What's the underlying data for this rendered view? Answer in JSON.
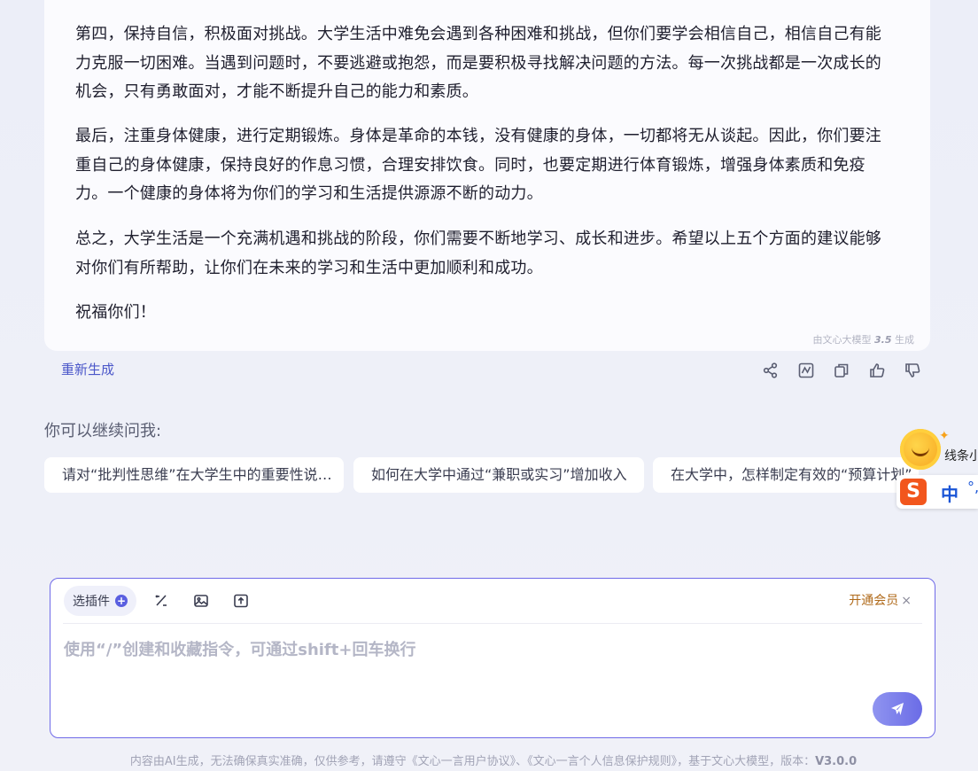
{
  "answer": {
    "paragraphs": [
      "第四，保持自信，积极面对挑战。大学生活中难免会遇到各种困难和挑战，但你们要学会相信自己，相信自己有能力克服一切困难。当遇到问题时，不要逃避或抱怨，而是要积极寻找解决问题的方法。每一次挑战都是一次成长的机会，只有勇敢面对，才能不断提升自己的能力和素质。",
      "最后，注重身体健康，进行定期锻炼。身体是革命的本钱，没有健康的身体，一切都将无从谈起。因此，你们要注重自己的身体健康，保持良好的作息习惯，合理安排饮食。同时，也要定期进行体育锻炼，增强身体素质和免疫力。一个健康的身体将为你们的学习和生活提供源源不断的动力。",
      "总之，大学生活是一个充满机遇和挑战的阶段，你们需要不断地学习、成长和进步。希望以上五个方面的建议能够对你们有所帮助，让你们在未来的学习和生活中更加顺利和成功。",
      "祝福你们！"
    ],
    "model_note_prefix": "由文心大模型",
    "model_note_version": "3.5",
    "model_note_suffix": "生成"
  },
  "actions": {
    "regenerate_label": "重新生成",
    "icons": [
      "share-icon",
      "chart-icon",
      "copy-icon",
      "thumbs-up-icon",
      "thumbs-down-icon"
    ]
  },
  "suggestions": {
    "title": "你可以继续问我:",
    "items": [
      "请对“批判性思维”在大学生中的重要性说…",
      "如何在大学中通过“兼职或实习”增加收入",
      "在大学中，怎样制定有效的“预算计划”"
    ]
  },
  "ime": {
    "bubble_text": "线条小",
    "logo": "S",
    "mode": "中",
    "punct": "°,"
  },
  "composer": {
    "plugin_label": "选插件",
    "plus": "+",
    "vip_label": "开通会员",
    "vip_close": "×",
    "placeholder": "使用“/”创建和收藏指令，可通过shift+回车换行"
  },
  "footer": {
    "text": "内容由AI生成，无法确保真实准确，仅供参考，请遵守《文心一言用户协议》、《文心一言个人信息保护规则》，基于文心大模型，版本：",
    "version": "V3.0.0"
  },
  "colors": {
    "accent": "#5a5fe0",
    "border": "#6f6ae8",
    "vip": "#b06a1a"
  }
}
